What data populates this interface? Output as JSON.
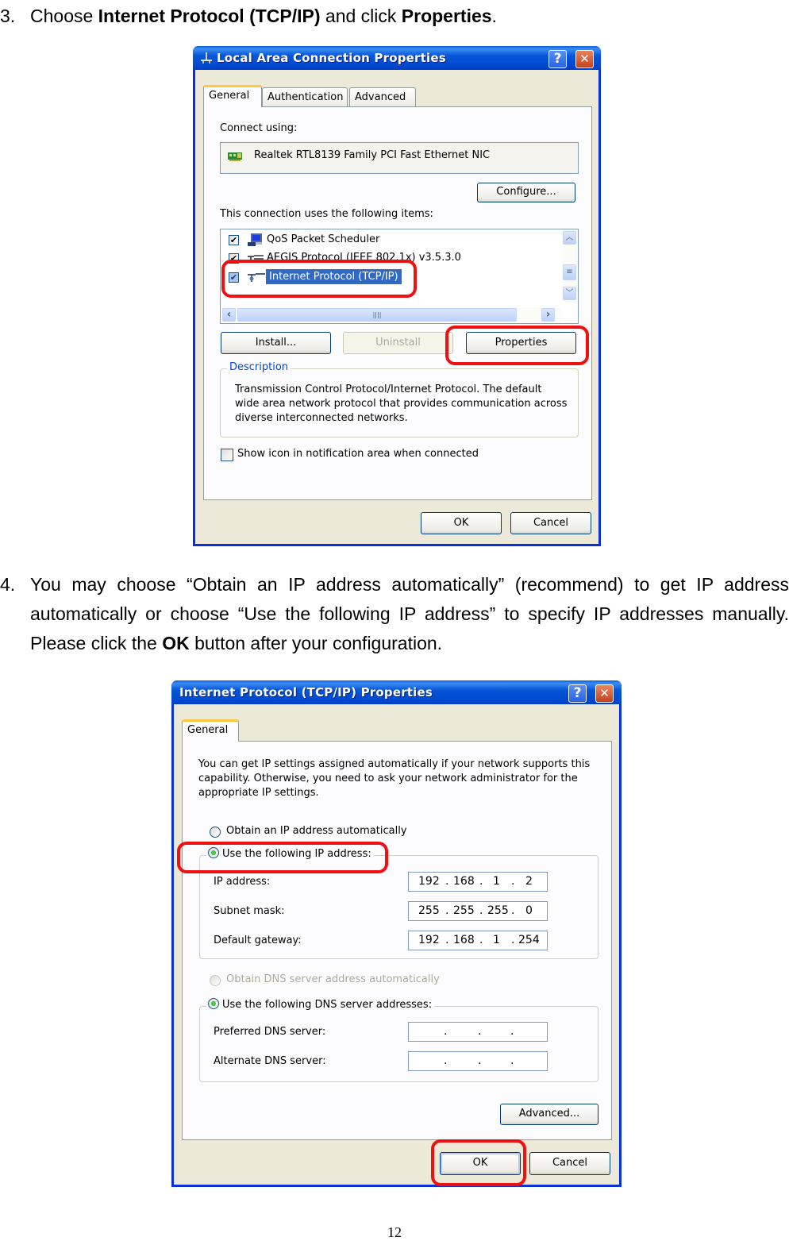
{
  "step3": {
    "number": "3.",
    "text_pre": "Choose ",
    "bold1": "Internet Protocol (TCP/IP)",
    "text_mid": " and click ",
    "bold2": "Properties",
    "text_post": "."
  },
  "dialog1": {
    "title": "Local Area Connection Properties",
    "help_glyph": "?",
    "close_glyph": "✕",
    "tabs": [
      {
        "label": "General",
        "active": true
      },
      {
        "label": "Authentication",
        "active": false
      },
      {
        "label": "Advanced",
        "active": false
      }
    ],
    "connect_using_label": "Connect using:",
    "adapter_name": "Realtek RTL8139 Family PCI Fast Ethernet NIC",
    "configure_button": "Configure...",
    "items_label": "This connection uses the following items:",
    "items": [
      {
        "label": "QoS Packet Scheduler",
        "checked": true,
        "selected": false,
        "icon": "qos-scheduler-icon"
      },
      {
        "label": "AEGIS Protocol (IEEE 802.1x) v3.5.3.0",
        "checked": true,
        "selected": false,
        "icon": "network-protocol-icon"
      },
      {
        "label": "Internet Protocol (TCP/IP)",
        "checked": true,
        "selected": true,
        "icon": "network-protocol-icon"
      }
    ],
    "check_glyph": "✔",
    "scroll_up": "︿",
    "scroll_down": "﹀",
    "scroll_left": "‹",
    "scroll_right": "›",
    "install_button": "Install...",
    "uninstall_button": "Uninstall",
    "properties_button": "Properties",
    "description_legend": "Description",
    "description_text": "Transmission Control Protocol/Internet Protocol. The default wide area network protocol that provides communication across diverse interconnected networks.",
    "show_icon_label": "Show icon in notification area when connected",
    "show_icon_checked": false,
    "ok_button": "OK",
    "cancel_button": "Cancel"
  },
  "step4": {
    "number": "4.",
    "text_pre": "You may choose “Obtain an IP address automatically” (recommend) to get IP address automatically or choose “Use the following IP address” to specify IP addresses manually. Please click the ",
    "bold": "OK",
    "text_post": " button after your configuration."
  },
  "dialog2": {
    "title": "Internet Protocol (TCP/IP) Properties",
    "help_glyph": "?",
    "close_glyph": "✕",
    "tabs": [
      {
        "label": "General",
        "active": true
      }
    ],
    "intro_text": "You can get IP settings assigned automatically if your network supports this capability. Otherwise, you need to ask your network administrator for the appropriate IP settings.",
    "obtain_ip_auto_label": "Obtain an IP address automatically",
    "use_following_ip_label": "Use the following IP address:",
    "ip_mode_selected": "use_following",
    "ip_fields": [
      {
        "label": "IP address:",
        "octets": [
          "192",
          "168",
          "1",
          "2"
        ]
      },
      {
        "label": "Subnet mask:",
        "octets": [
          "255",
          "255",
          "255",
          "0"
        ]
      },
      {
        "label": "Default gateway:",
        "octets": [
          "192",
          "168",
          "1",
          "254"
        ]
      }
    ],
    "obtain_dns_auto_label": "Obtain DNS server address automatically",
    "use_following_dns_label": "Use the following DNS server addresses:",
    "dns_mode_selected": "use_following",
    "dns_fields": [
      {
        "label": "Preferred DNS server:",
        "octets": [
          "",
          "",
          "",
          ""
        ]
      },
      {
        "label": "Alternate DNS server:",
        "octets": [
          "",
          "",
          "",
          ""
        ]
      }
    ],
    "advanced_button": "Advanced...",
    "ok_button": "OK",
    "cancel_button": "Cancel"
  },
  "page_number": "12",
  "colors": {
    "highlight": "#ee1111",
    "xp_titlebar": "#0148cf",
    "selection": "#316ac5"
  }
}
